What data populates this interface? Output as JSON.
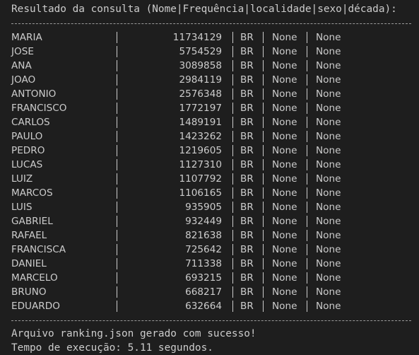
{
  "terminal": {
    "header": "Resultado da consulta (Nome|Frequência|localidade|sexo|década):",
    "rows": [
      {
        "name": "MARIA",
        "frequency": "11734129",
        "locality": "BR",
        "sex": "None",
        "decade": "None"
      },
      {
        "name": "JOSE",
        "frequency": "5754529",
        "locality": "BR",
        "sex": "None",
        "decade": "None"
      },
      {
        "name": "ANA",
        "frequency": "3089858",
        "locality": "BR",
        "sex": "None",
        "decade": "None"
      },
      {
        "name": "JOAO",
        "frequency": "2984119",
        "locality": "BR",
        "sex": "None",
        "decade": "None"
      },
      {
        "name": "ANTONIO",
        "frequency": "2576348",
        "locality": "BR",
        "sex": "None",
        "decade": "None"
      },
      {
        "name": "FRANCISCO",
        "frequency": "1772197",
        "locality": "BR",
        "sex": "None",
        "decade": "None"
      },
      {
        "name": "CARLOS",
        "frequency": "1489191",
        "locality": "BR",
        "sex": "None",
        "decade": "None"
      },
      {
        "name": "PAULO",
        "frequency": "1423262",
        "locality": "BR",
        "sex": "None",
        "decade": "None"
      },
      {
        "name": "PEDRO",
        "frequency": "1219605",
        "locality": "BR",
        "sex": "None",
        "decade": "None"
      },
      {
        "name": "LUCAS",
        "frequency": "1127310",
        "locality": "BR",
        "sex": "None",
        "decade": "None"
      },
      {
        "name": "LUIZ",
        "frequency": "1107792",
        "locality": "BR",
        "sex": "None",
        "decade": "None"
      },
      {
        "name": "MARCOS",
        "frequency": "1106165",
        "locality": "BR",
        "sex": "None",
        "decade": "None"
      },
      {
        "name": "LUIS",
        "frequency": "935905",
        "locality": "BR",
        "sex": "None",
        "decade": "None"
      },
      {
        "name": "GABRIEL",
        "frequency": "932449",
        "locality": "BR",
        "sex": "None",
        "decade": "None"
      },
      {
        "name": "RAFAEL",
        "frequency": "821638",
        "locality": "BR",
        "sex": "None",
        "decade": "None"
      },
      {
        "name": "FRANCISCA",
        "frequency": "725642",
        "locality": "BR",
        "sex": "None",
        "decade": "None"
      },
      {
        "name": "DANIEL",
        "frequency": "711338",
        "locality": "BR",
        "sex": "None",
        "decade": "None"
      },
      {
        "name": "MARCELO",
        "frequency": "693215",
        "locality": "BR",
        "sex": "None",
        "decade": "None"
      },
      {
        "name": "BRUNO",
        "frequency": "668217",
        "locality": "BR",
        "sex": "None",
        "decade": "None"
      },
      {
        "name": "EDUARDO",
        "frequency": "632664",
        "locality": "BR",
        "sex": "None",
        "decade": "None"
      }
    ],
    "success_message": "Arquivo ranking.json gerado com sucesso!",
    "timing_message": "Tempo de execução: 5.11 segundos."
  },
  "colors": {
    "background": "#1e1e1e",
    "text": "#cccccc",
    "dashes": "#9a9a9a"
  }
}
